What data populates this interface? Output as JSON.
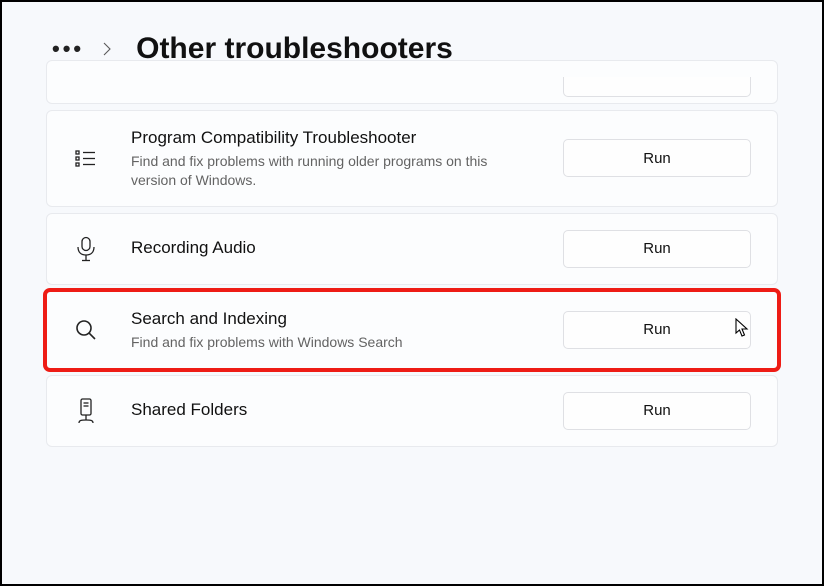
{
  "header": {
    "title": "Other troubleshooters"
  },
  "run_label": "Run",
  "items": [
    {
      "title": "Program Compatibility Troubleshooter",
      "desc": "Find and fix problems with running older programs on this version of Windows."
    },
    {
      "title": "Recording Audio",
      "desc": ""
    },
    {
      "title": "Search and Indexing",
      "desc": "Find and fix problems with Windows Search"
    },
    {
      "title": "Shared Folders",
      "desc": ""
    }
  ]
}
